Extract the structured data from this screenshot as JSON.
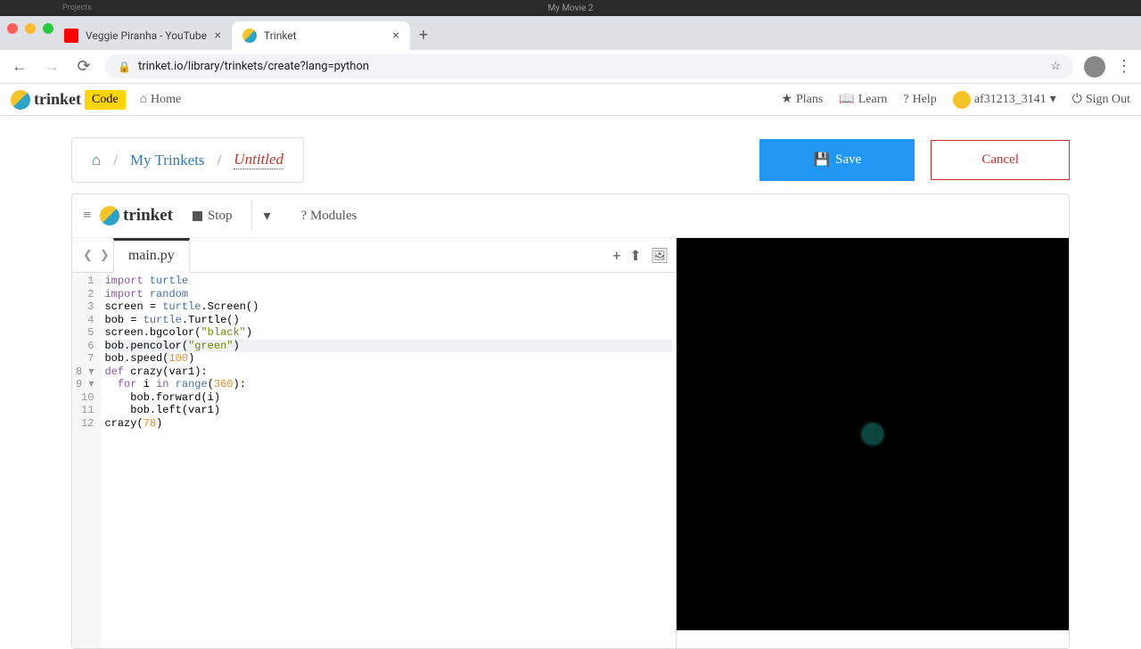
{
  "os": {
    "title": "My Movie 2",
    "left_items": [
      "Projects"
    ]
  },
  "tabs": [
    {
      "label": "Veggie Piranha - YouTube",
      "active": false
    },
    {
      "label": "Trinket",
      "active": true
    }
  ],
  "url": "trinket.io/library/trinkets/create?lang=python",
  "header": {
    "brand": "trinket",
    "badge": "Code",
    "home": "Home",
    "plans": "Plans",
    "learn": "Learn",
    "help": "Help",
    "username": "af31213_3141",
    "signout": "Sign Out"
  },
  "breadcrumb": {
    "my_trinkets": "My Trinkets",
    "untitled": "Untitled"
  },
  "buttons": {
    "save": "Save",
    "cancel": "Cancel"
  },
  "ide": {
    "brand": "trinket",
    "stop": "Stop",
    "modules": "Modules",
    "file_tab": "main.py",
    "active_line": 6
  },
  "code": [
    {
      "n": 1,
      "raw": "import turtle"
    },
    {
      "n": 2,
      "raw": "import random"
    },
    {
      "n": 3,
      "raw": "screen = turtle.Screen()"
    },
    {
      "n": 4,
      "raw": "bob = turtle.Turtle()"
    },
    {
      "n": 5,
      "raw": "screen.bgcolor(\"black\")"
    },
    {
      "n": 6,
      "raw": "bob.pencolor(\"green\")"
    },
    {
      "n": 7,
      "raw": "bob.speed(100)"
    },
    {
      "n": 8,
      "raw": "def crazy(var1):"
    },
    {
      "n": 9,
      "raw": "  for i in range(360):"
    },
    {
      "n": 10,
      "raw": "    bob.forward(i)"
    },
    {
      "n": 11,
      "raw": "    bob.left(var1)"
    },
    {
      "n": 12,
      "raw": "crazy(78)"
    }
  ],
  "turtle": {
    "bgcolor": "#000000",
    "pencolor": "#2dd4bf",
    "angle": 78,
    "iterations": 360
  }
}
